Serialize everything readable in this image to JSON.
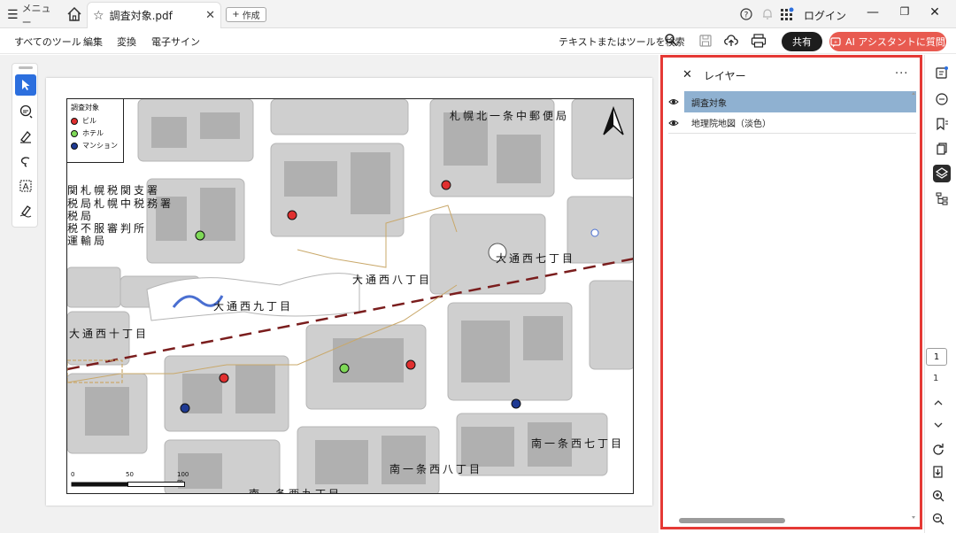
{
  "titlebar": {
    "menu_label": "メニュー",
    "tab_title": "調査対象.pdf",
    "create_label": "作成",
    "login_label": "ログイン"
  },
  "menubar": {
    "items": [
      "すべてのツール",
      "編集",
      "変換",
      "電子サイン"
    ],
    "search_placeholder": "テキストまたはツールを検索",
    "share_label": "共有",
    "ai_label": "AI アシスタントに質問"
  },
  "map": {
    "legend": {
      "title": "調査対象",
      "items": [
        {
          "label": "ビル",
          "color": "#e02f2f"
        },
        {
          "label": "ホテル",
          "color": "#7ed957"
        },
        {
          "label": "マンション",
          "color": "#1f3a93"
        }
      ]
    },
    "labels": {
      "post_office": "札幌北一条中郵便局",
      "tax_lines": [
        "関札幌税関支署",
        "税局札幌中税務署",
        "税局",
        "税不服審判所",
        "運輸局"
      ],
      "odori7": "大通西七丁目",
      "odori8": "大通西八丁目",
      "odori9": "大通西九丁目",
      "odori10": "大通西十丁目",
      "minami7": "南一条西七丁目",
      "minami8": "南一条西八丁目",
      "minami9": "南一条西九丁目"
    },
    "scale": {
      "s0": "0",
      "s50": "50",
      "s100": "100 m"
    }
  },
  "layers": {
    "title": "レイヤー",
    "items": [
      {
        "name": "調査対象",
        "selected": true
      },
      {
        "name": "地理院地図（淡色）",
        "selected": false
      }
    ]
  },
  "nav": {
    "page_current": "1",
    "page_total": "1"
  },
  "colors": {
    "accent_blue": "#2c6fde",
    "ai_red": "#e85a50",
    "highlight_red": "#e53935",
    "layer_selected": "#8fb1d1"
  }
}
